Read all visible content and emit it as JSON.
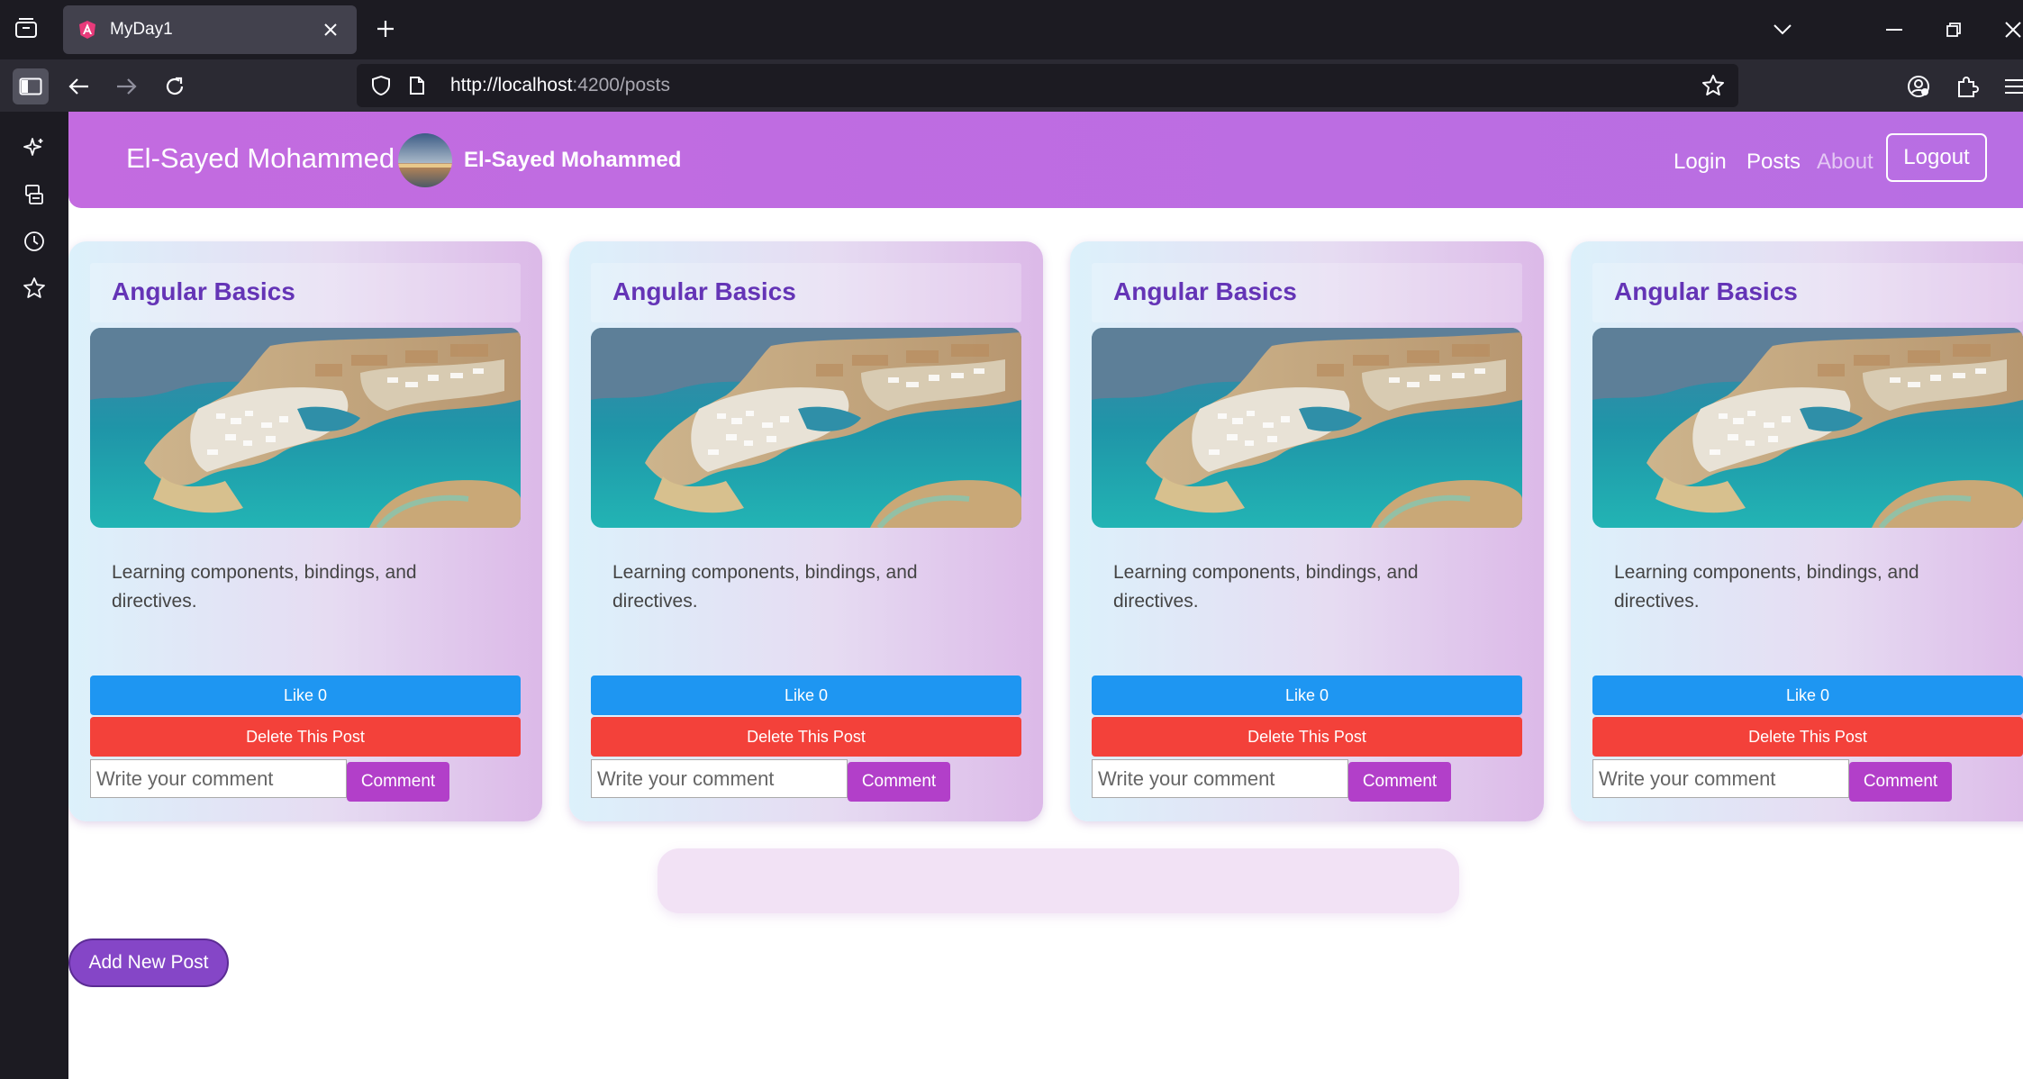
{
  "browser": {
    "tab_title": "MyDay1",
    "url_host": "http://localhost",
    "url_rest": ":4200/posts"
  },
  "header": {
    "brand": "El-Sayed Mohammed",
    "user_name": "El-Sayed Mohammed",
    "nav": {
      "login": "Login",
      "posts": "Posts",
      "about": "About"
    },
    "logout_label": "Logout"
  },
  "posts": [
    {
      "title": "Angular Basics",
      "body": "Learning components, bindings, and directives.",
      "like_label": "Like 0",
      "delete_label": "Delete This Post",
      "comment_placeholder": "Write your comment",
      "comment_label": "Comment"
    },
    {
      "title": "Angular Basics",
      "body": "Learning components, bindings, and directives.",
      "like_label": "Like 0",
      "delete_label": "Delete This Post",
      "comment_placeholder": "Write your comment",
      "comment_label": "Comment"
    },
    {
      "title": "Angular Basics",
      "body": "Learning components, bindings, and directives.",
      "like_label": "Like 0",
      "delete_label": "Delete This Post",
      "comment_placeholder": "Write your comment",
      "comment_label": "Comment"
    },
    {
      "title": "Angular Basics",
      "body": "Learning components, bindings, and directives.",
      "like_label": "Like 0",
      "delete_label": "Delete This Post",
      "comment_placeholder": "Write your comment",
      "comment_label": "Comment"
    }
  ],
  "add_post_label": "Add New Post",
  "colors": {
    "header": "#c36be0",
    "title": "#6434b6",
    "like": "#1e96f2",
    "delete": "#f3413a",
    "comment": "#b23fc9",
    "add_post": "#8546c7"
  },
  "icons": {
    "tab_list": "tab-list-icon",
    "favicon": "angular-favicon-icon",
    "close": "close-icon",
    "new_tab": "plus-icon",
    "back": "back-arrow-icon",
    "forward": "forward-arrow-icon",
    "reload": "reload-icon",
    "shield": "shield-icon",
    "page": "page-icon",
    "bookmark": "star-icon",
    "account": "account-icon",
    "extensions": "puzzle-icon",
    "menu": "hamburger-menu-icon"
  }
}
